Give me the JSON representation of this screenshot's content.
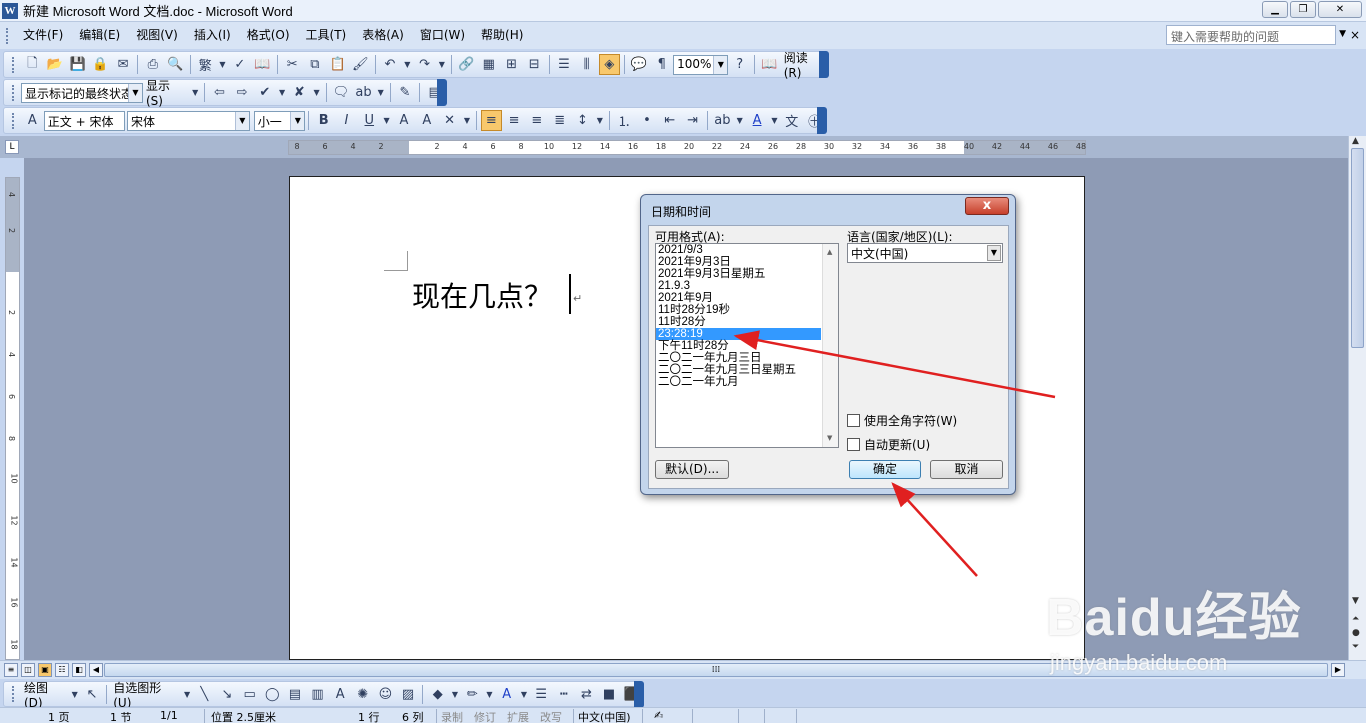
{
  "window": {
    "title": "新建 Microsoft Word 文档.doc - Microsoft Word",
    "app_icon": "W",
    "controls": [
      "minimize-icon",
      "restore-icon",
      "close-icon"
    ]
  },
  "menubar": {
    "items": [
      "文件(F)",
      "编辑(E)",
      "视图(V)",
      "插入(I)",
      "格式(O)",
      "工具(T)",
      "表格(A)",
      "窗口(W)",
      "帮助(H)"
    ],
    "help_placeholder": "键入需要帮助的问题",
    "close_glyph": "×"
  },
  "standard_toolbar": {
    "zoom": "100%",
    "reading_label": "阅读(R)"
  },
  "review_toolbar": {
    "display_state": "显示标记的最终状态",
    "show_label": "显示(S)"
  },
  "format_toolbar": {
    "style": "正文 + 宋体",
    "font": "宋体",
    "size": "小一"
  },
  "rulers": {
    "horizontal_numbers": [
      "8",
      "6",
      "4",
      "2",
      "2",
      "4",
      "6",
      "8",
      "10",
      "12",
      "14",
      "16",
      "18",
      "20",
      "22",
      "24",
      "26",
      "28",
      "30",
      "32",
      "34",
      "36",
      "38",
      "40",
      "42",
      "44",
      "46",
      "48"
    ],
    "vertical_numbers": [
      "4",
      "2",
      "2",
      "4",
      "6",
      "8",
      "10",
      "12",
      "14",
      "16",
      "18"
    ],
    "corner": "L"
  },
  "document": {
    "text": "现在几点？",
    "para_mark": "↵"
  },
  "dialog": {
    "title": "日期和时间",
    "close_glyph": "x",
    "formats_label": "可用格式(A):",
    "formats": [
      "2021/9/3",
      "2021年9月3日",
      "2021年9月3日星期五",
      "21.9.3",
      "2021年9月",
      "11时28分19秒",
      "11时28分",
      "23:28:19",
      "下午11时28分",
      "二〇二一年九月三日",
      "二〇二一年九月三日星期五",
      "二〇二一年九月"
    ],
    "selected_index": 7,
    "language_label": "语言(国家/地区)(L):",
    "language_value": "中文(中国)",
    "fullwidth_label": "使用全角字符(W)",
    "autoupdate_label": "自动更新(U)",
    "default_button": "默认(D)...",
    "ok_button": "确定",
    "cancel_button": "取消"
  },
  "drawing_toolbar": {
    "draw_label": "绘图(D)",
    "autoshapes_label": "自选图形(U)"
  },
  "statusbar": {
    "page": "1 页",
    "section": "1 节",
    "page_of": "1/1",
    "position": "位置 2.5厘米",
    "line": "1 行",
    "column": "6 列",
    "rec": "录制",
    "trk": "修订",
    "ext": "扩展",
    "ovr": "改写",
    "language": "中文(中国)"
  },
  "watermark": {
    "logo": "Baidu经验",
    "url": "jingyan.baidu.com"
  },
  "annotation_color": "#e02020",
  "selection_color": "#3399ff"
}
